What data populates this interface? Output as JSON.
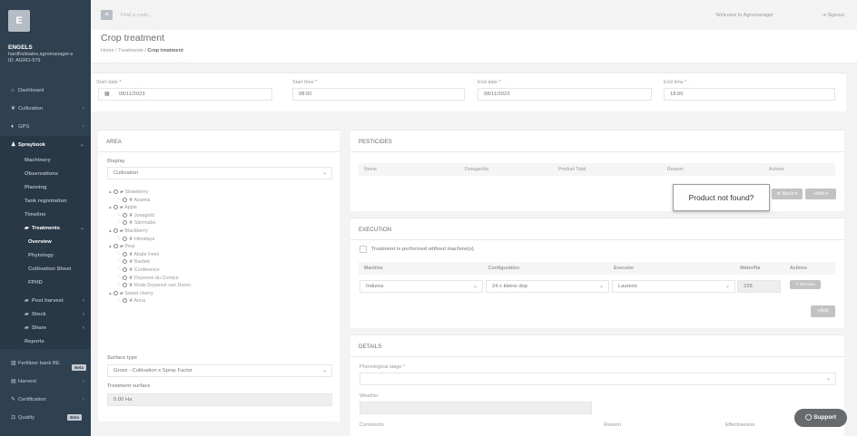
{
  "sidebar": {
    "avatar_letter": "E",
    "user_name": "ENGELS",
    "email": "hardfruitsales.agromanager.e",
    "user_id": "ID: AGRO-979",
    "items": [
      {
        "icon": "home-icon",
        "label": "Dashboard"
      },
      {
        "icon": "leaf-icon",
        "label": "Cultivation"
      },
      {
        "icon": "map-pin-icon",
        "label": "GPS"
      },
      {
        "icon": "flask-icon",
        "label": "Spraybook"
      }
    ],
    "spraybook_sub": [
      "Machinery",
      "Observations",
      "Planning",
      "Tank registration",
      "Timeline",
      "Treatments"
    ],
    "treatments_sub": [
      "Overview",
      "Phytology",
      "Cultivation Sheet",
      "FPHD"
    ],
    "post_items": [
      {
        "label": "Post harvest"
      },
      {
        "label": "Stock"
      },
      {
        "label": "Share"
      },
      {
        "label": "Reports"
      }
    ],
    "lower_items": [
      {
        "icon": "bank-icon",
        "label": "Fertilizer bank BE",
        "badge": "Beta"
      },
      {
        "icon": "harvest-icon",
        "label": "Harvest"
      },
      {
        "icon": "certificate-icon",
        "label": "Certification"
      },
      {
        "icon": "quality-icon",
        "label": "Quality",
        "badge": "Beta"
      }
    ]
  },
  "topbar": {
    "search_placeholder": "Find a code...",
    "welcome": "Welcome to Agromanager",
    "signout": "Signout"
  },
  "page": {
    "title": "Crop treatment",
    "breadcrumb": [
      "Home",
      "Treatments",
      "Crop treatment"
    ]
  },
  "dates": {
    "start_date_label": "Start date *",
    "start_date": "08/11/2023",
    "start_time_label": "Start time *",
    "start_time": "08:00",
    "end_date_label": "End date *",
    "end_date": "08/11/2023",
    "end_time_label": "End time *",
    "end_time": "18:00"
  },
  "area": {
    "title": "AREA",
    "display_label": "Display",
    "display_value": "Cultivation",
    "tree": [
      {
        "name": "Strawberry",
        "children": [
          "Asamia"
        ]
      },
      {
        "name": "Apple",
        "children": [
          "Jonagold",
          "Sterrnabo"
        ]
      },
      {
        "name": "Blackberry",
        "children": [
          "Himalaya"
        ]
      },
      {
        "name": "Pear",
        "children": [
          "Abate Fetel",
          "Bartlett",
          "Conference",
          "Doyenné du Comice",
          "Rode Doyenné van Doorn"
        ]
      },
      {
        "name": "Sweet cherry",
        "children": [
          "Anna"
        ]
      }
    ],
    "surface_type_label": "Surface type",
    "surface_type_value": "Gross - Cultivation x Spray Factor",
    "treatment_surface_label": "Treatment surface",
    "treatment_surface_value": "0.00 Ha"
  },
  "pesticides": {
    "title": "PESTICIDES",
    "columns": [
      "Name",
      "Dosage/Ha",
      "Product Total",
      "Reason",
      "Actions"
    ],
    "stock_button": "Stock",
    "add_button": "Add",
    "tooltip": "Product not found?"
  },
  "execution": {
    "title": "EXECUTION",
    "no_machine_label": "Treatment is performed without machine(s)",
    "columns": [
      "Machine",
      "Configuration",
      "Executor",
      "Water/Ha",
      "Actions"
    ],
    "row": {
      "machine": "Induma",
      "configuration": "24 x kleine dop",
      "executor": "Laurens",
      "water": "228",
      "remove": "Remove"
    },
    "add_button": "Add"
  },
  "details": {
    "title": "DETAILS",
    "phenological_label": "Phenological stage *",
    "weather_label": "Weather",
    "comments_label": "Comments",
    "reason_label": "Reason",
    "effectiveness_label": "Effectiveness"
  },
  "support_label": "Support"
}
